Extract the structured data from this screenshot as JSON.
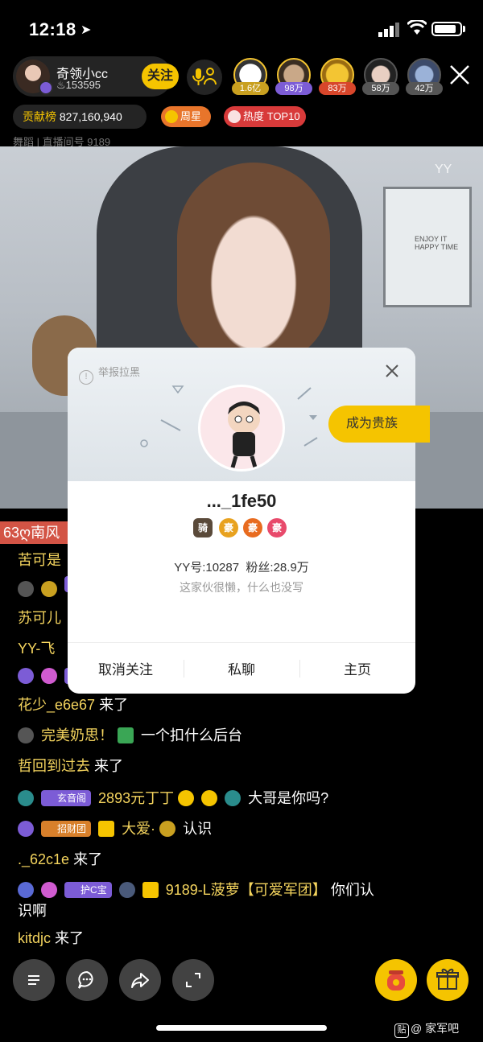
{
  "status_bar": {
    "time": "12:18"
  },
  "host": {
    "name": "奇领小cc",
    "fans": "153595",
    "follow_label": "关注"
  },
  "viewers": [
    {
      "count": "1.6亿",
      "color": "#c9a020"
    },
    {
      "count": "98万",
      "color": "#7c5cd6"
    },
    {
      "count": "83万",
      "color": "#d8462b"
    },
    {
      "count": "58万",
      "color": "#555555"
    },
    {
      "count": "42万",
      "color": "#555555"
    }
  ],
  "contribution": {
    "label": "贡献榜",
    "value": "827,160,940"
  },
  "badges": {
    "week": "周星",
    "hot": "热度 TOP10"
  },
  "room_info": "舞蹈 | 直播间号 9189",
  "video_watermark": "YY",
  "poster_text": "ENJOY IT\nHAPPY TIME",
  "chat_top_name": "63ღ南风",
  "chat": [
    {
      "name": "苦可是",
      "text": ""
    },
    {
      "name": "",
      "text": ""
    },
    {
      "name": "苏可儿",
      "text": ""
    },
    {
      "name": "YY-飞",
      "text": ""
    },
    {
      "name": "",
      "text": ""
    },
    {
      "name": "花少_e6e67",
      "text": "来了"
    },
    {
      "name": "完美奶思！",
      "text": "一个扣什么后台"
    },
    {
      "name": "哲回到过去",
      "text": "来了"
    },
    {
      "name": "2893元丁丁",
      "text": "大哥是你吗?"
    },
    {
      "name": "大爱·",
      "text": "认识"
    },
    {
      "name": "._62c1e",
      "text": "来了"
    },
    {
      "name": "9189-L菠萝【可爱军团】",
      "text": "你们认"
    },
    {
      "name": "识啊",
      "text": ""
    },
    {
      "name": "kitdjc",
      "text": "来了"
    }
  ],
  "chat_pills": {
    "guard": "护",
    "xuanyin": "玄音阁",
    "zhaocai": "招财团",
    "guard_c": "护C宝"
  },
  "profile_card": {
    "report_label": "举报拉黑",
    "noble_label": "成为贵族",
    "username": "..._1fe50",
    "levels": [
      "豪",
      "豪",
      "豪"
    ],
    "yy_id_label": "YY号:10287",
    "fans_label": "粉丝:28.9万",
    "signature": "这家伙很懒，什么也没写",
    "actions": [
      "取消关注",
      "私聊",
      "主页"
    ]
  },
  "credit": {
    "badge": "贴",
    "text": "@ 家军吧"
  }
}
